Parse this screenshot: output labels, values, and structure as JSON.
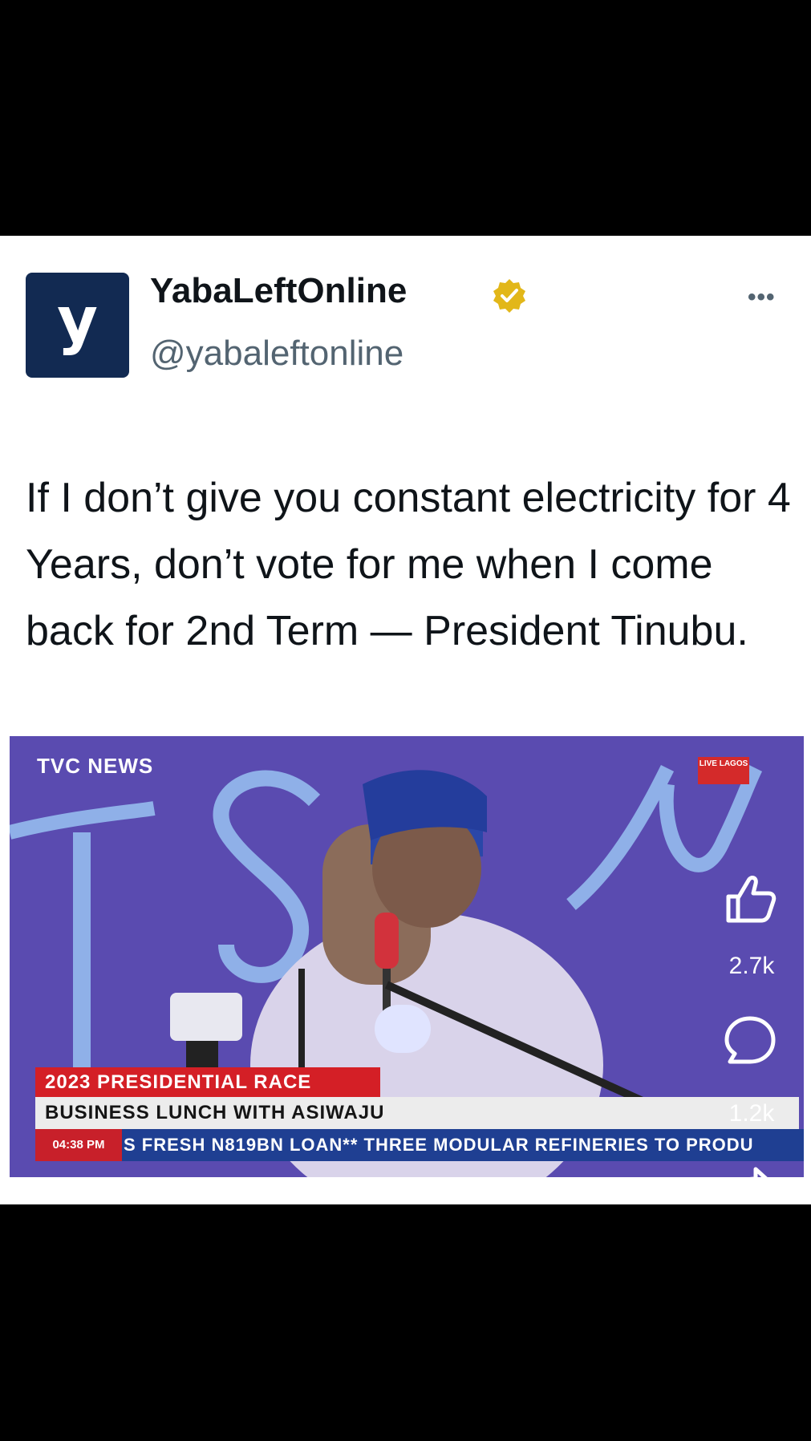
{
  "post": {
    "avatar_letter": "y",
    "display_name": "YabaLeftOnline",
    "handle": "@yabaleftonline",
    "more_label": "•••",
    "text": "If I don’t give you constant electricity for 4 Years, don’t vote for me when I come back for 2nd Term — President Tinubu.",
    "verified_badge_icon": "verified-badge-icon",
    "brand_color": "#122a52"
  },
  "media": {
    "channel_label": "TVC NEWS",
    "live_label": "LIVE LAGOS",
    "headline": "2023 PRESIDENTIAL RACE",
    "subheadline": "BUSINESS LUNCH WITH ASIWAJU",
    "ticker_time": "04:38 PM",
    "ticker_text": "S FRESH N819BN LOAN** THREE MODULAR REFINERIES TO PRODU"
  },
  "actions": {
    "like_icon": "thumbs-up-icon",
    "like_count": "2.7k",
    "comment_icon": "comment-icon",
    "comment_count": "1.2k",
    "share_icon": "share-icon"
  }
}
